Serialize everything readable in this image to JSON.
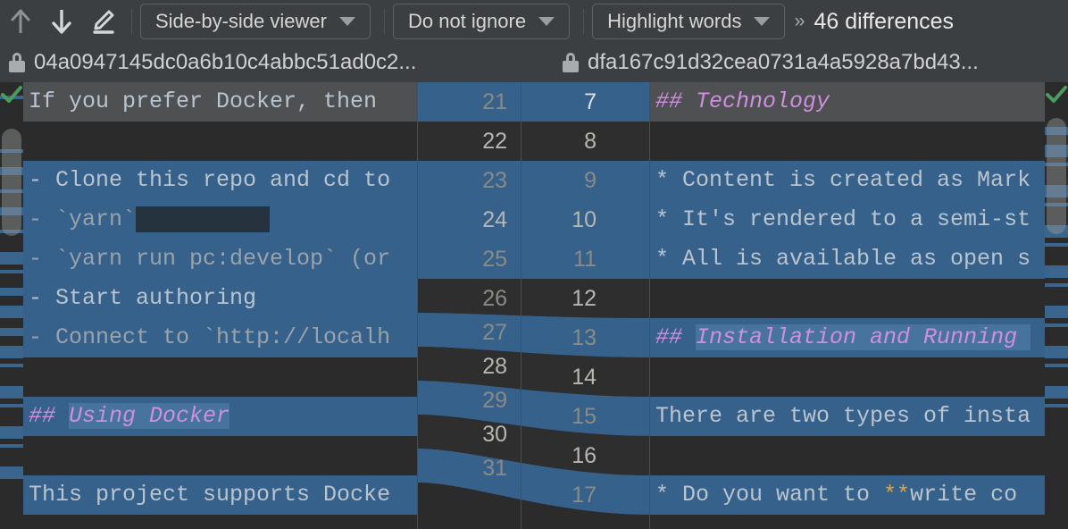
{
  "toolbar": {
    "icons": [
      {
        "name": "previous-difference-icon",
        "glyph": "arrow-up"
      },
      {
        "name": "next-difference-icon",
        "glyph": "arrow-down"
      },
      {
        "name": "edit-icon",
        "glyph": "pencil"
      }
    ],
    "viewer_mode": "Side-by-side viewer",
    "ignore_mode": "Do not ignore",
    "highlight_mode": "Highlight words",
    "overflow_label": "››",
    "difference_count": "46 differences"
  },
  "paths": {
    "left": "04a0947145dc0a6b10c4abbc51ad0c2...",
    "right": "dfa167c91d32cea0731a4a5928a7bd43..."
  },
  "colors": {
    "toolbar_bg": "#3c3f41",
    "editor_bg": "#2b2b2b",
    "diff_changed": "#36618a",
    "diff_word": "#47749f",
    "cursor_line": "#4e5052",
    "markdown_heading": "#cf8ee0",
    "markdown_bold": "#e8a33d",
    "accepted_check": "#4a9e5c",
    "minimap_mark": "#3a658d"
  },
  "status": {
    "left_accepted_icon": "check-icon",
    "right_accepted_icon": "check-icon"
  },
  "left_pane": {
    "lines": [
      {
        "num": "21",
        "kind": "cursor",
        "segments": [
          {
            "t": "If you prefer Docker, then",
            "c": "plain"
          }
        ]
      },
      {
        "num": "22",
        "kind": "plain",
        "segments": []
      },
      {
        "num": "23",
        "kind": "changed",
        "segments": [
          {
            "t": "- Clone this repo and cd to",
            "c": "plain"
          }
        ]
      },
      {
        "num": "24",
        "kind": "changed",
        "segments": [
          {
            "t": "- `yarn`",
            "c": "dim"
          },
          {
            "t": "          ",
            "c": "worddel"
          }
        ]
      },
      {
        "num": "25",
        "kind": "changed",
        "segments": [
          {
            "t": "- `yarn run pc:develop` (or",
            "c": "dim"
          }
        ]
      },
      {
        "num": "26",
        "kind": "changed",
        "segments": [
          {
            "t": "- Start authoring",
            "c": "plain"
          }
        ]
      },
      {
        "num": "27",
        "kind": "changed",
        "segments": [
          {
            "t": "- Connect to `http://localh",
            "c": "dim"
          }
        ]
      },
      {
        "num": "28",
        "kind": "plain",
        "segments": []
      },
      {
        "num": "29",
        "kind": "changed",
        "segments": [
          {
            "t": "## ",
            "c": "hash"
          },
          {
            "t": "Using Docker",
            "c": "head-hl"
          }
        ]
      },
      {
        "num": "30",
        "kind": "plain",
        "segments": []
      },
      {
        "num": "31",
        "kind": "changed",
        "segments": [
          {
            "t": "This project supports Docke",
            "c": "plain"
          }
        ]
      }
    ]
  },
  "right_pane": {
    "lines": [
      {
        "num": "7",
        "kind": "cursor",
        "segments": [
          {
            "t": "## ",
            "c": "hash"
          },
          {
            "t": "Technology",
            "c": "head"
          }
        ]
      },
      {
        "num": "8",
        "kind": "plain",
        "segments": []
      },
      {
        "num": "9",
        "kind": "changed",
        "segments": [
          {
            "t": "* Content is created as Mark",
            "c": "plain"
          }
        ]
      },
      {
        "num": "10",
        "kind": "changed",
        "segments": [
          {
            "t": "* It's rendered to a semi-st",
            "c": "plain"
          }
        ]
      },
      {
        "num": "11",
        "kind": "changed",
        "segments": [
          {
            "t": "* All is available as open s",
            "c": "plain"
          }
        ]
      },
      {
        "num": "12",
        "kind": "plain",
        "segments": []
      },
      {
        "num": "13",
        "kind": "changed",
        "segments": [
          {
            "t": "## ",
            "c": "hash"
          },
          {
            "t": "Installation and Running ",
            "c": "head-hl"
          }
        ]
      },
      {
        "num": "14",
        "kind": "plain",
        "segments": []
      },
      {
        "num": "15",
        "kind": "changed",
        "segments": [
          {
            "t": "There are two types of insta",
            "c": "plain"
          }
        ]
      },
      {
        "num": "16",
        "kind": "plain",
        "segments": []
      },
      {
        "num": "17",
        "kind": "changed",
        "segments": [
          {
            "t": "* Do you want to ",
            "c": "plain"
          },
          {
            "t": "**",
            "c": "bold"
          },
          {
            "t": "write co",
            "c": "plain"
          }
        ]
      }
    ]
  },
  "gutter": {
    "left_numbers": [
      "21",
      "22",
      "23",
      "24",
      "25",
      "26",
      "27",
      "28",
      "29",
      "30",
      "31"
    ],
    "right_numbers": [
      "7",
      "8",
      "9",
      "10",
      "11",
      "12",
      "13",
      "14",
      "15",
      "16",
      "17"
    ]
  },
  "minimap": {
    "left_marks": [
      3,
      15,
      19,
      24,
      28,
      33,
      38,
      42,
      46,
      50,
      55,
      59,
      63,
      68,
      72,
      77,
      81,
      86
    ],
    "right_marks": [
      10,
      14,
      18,
      23,
      27,
      32,
      36,
      41,
      45,
      50,
      54,
      59,
      63,
      68,
      72
    ]
  }
}
